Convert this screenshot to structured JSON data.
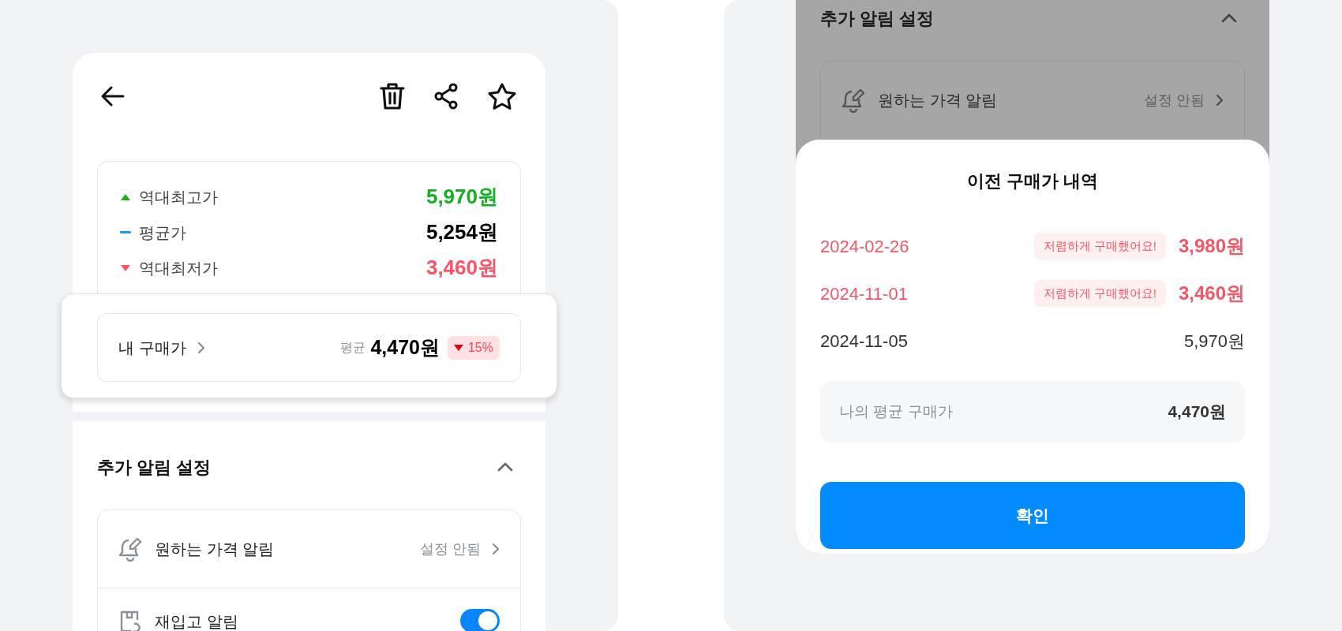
{
  "left_screen": {
    "price_summary": [
      {
        "kind": "high",
        "label": "역대최고가",
        "value": "5,970원"
      },
      {
        "kind": "average",
        "label": "평균가",
        "value": "5,254원"
      },
      {
        "kind": "low",
        "label": "역대최저가",
        "value": "3,460원"
      }
    ],
    "my_price": {
      "label": "내 구매가",
      "prefix": "평균",
      "value": "4,470원",
      "change": "15%"
    },
    "alerts": {
      "title": "추가 알림 설정",
      "expanded": true,
      "items": [
        {
          "kind": "link",
          "label": "원하는 가격 알림",
          "value": "설정 안됨"
        },
        {
          "kind": "toggle",
          "label": "재입고 알림",
          "on": true
        }
      ]
    }
  },
  "right_screen": {
    "background": {
      "title": "추가 알림 설정",
      "expanded": true,
      "item": {
        "label": "원하는 가격 알림",
        "value": "설정 안됨"
      }
    },
    "sheet": {
      "title": "이전 구매가 내역",
      "purchases": [
        {
          "date": "2024-02-26",
          "badge": "저렴하게 구매했어요!",
          "price": "3,980원",
          "cheap": true
        },
        {
          "date": "2024-11-01",
          "badge": "저렴하게 구매했어요!",
          "price": "3,460원",
          "cheap": true
        },
        {
          "date": "2024-11-05",
          "price": "5,970원",
          "cheap": false
        }
      ],
      "average": {
        "label": "나의 평균 구매가",
        "value": "4,470원"
      },
      "confirm": "확인"
    }
  }
}
